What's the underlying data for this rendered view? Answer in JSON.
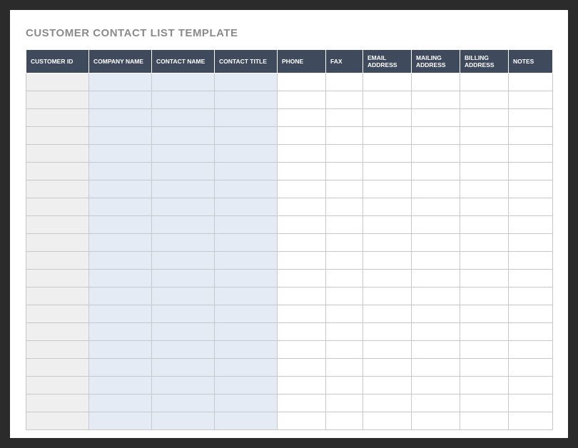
{
  "title": "CUSTOMER CONTACT LIST TEMPLATE",
  "columns": [
    {
      "label": "CUSTOMER ID",
      "class": "col-id",
      "width": "w-id"
    },
    {
      "label": "COMPANY NAME",
      "class": "col-blue",
      "width": "w-company"
    },
    {
      "label": "CONTACT NAME",
      "class": "col-blue",
      "width": "w-contactname"
    },
    {
      "label": "CONTACT TITLE",
      "class": "col-blue",
      "width": "w-contacttitle"
    },
    {
      "label": "PHONE",
      "class": "col-white",
      "width": "w-phone"
    },
    {
      "label": "FAX",
      "class": "col-white",
      "width": "w-fax"
    },
    {
      "label": "EMAIL ADDRESS",
      "class": "col-white",
      "width": "w-email"
    },
    {
      "label": "MAILING ADDRESS",
      "class": "col-white",
      "width": "w-mailing"
    },
    {
      "label": "BILLING ADDRESS",
      "class": "col-white",
      "width": "w-billing"
    },
    {
      "label": "NOTES",
      "class": "col-white",
      "width": "w-notes"
    }
  ],
  "rowCount": 20
}
